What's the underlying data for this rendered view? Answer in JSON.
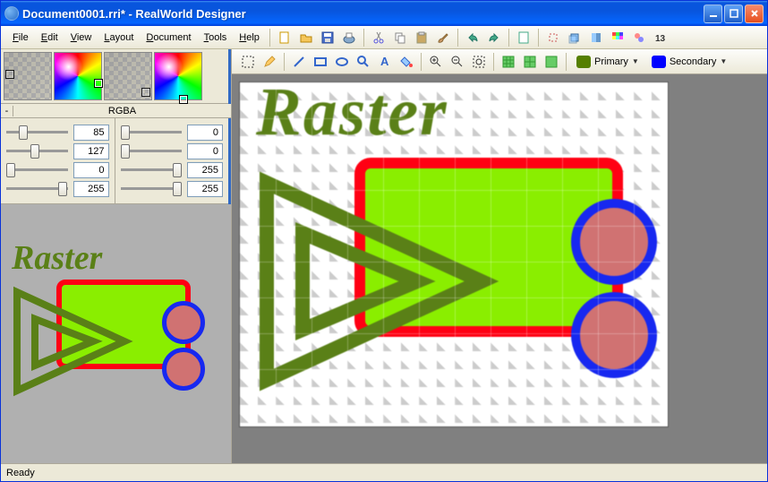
{
  "window": {
    "title": "Document0001.rri* - RealWorld Designer"
  },
  "menu": {
    "file": "File",
    "edit": "Edit",
    "view": "View",
    "layout": "Layout",
    "document": "Document",
    "tools": "Tools",
    "help": "Help"
  },
  "rgba": {
    "label": "RGBA",
    "minus": "-",
    "left": {
      "r": "85",
      "g": "127",
      "b": "0",
      "a": "255"
    },
    "right": {
      "r": "0",
      "g": "0",
      "b": "255",
      "a": "255"
    }
  },
  "color_dropdowns": {
    "primary_label": "Primary",
    "primary_color": "#557f00",
    "secondary_label": "Secondary",
    "secondary_color": "#0000ff"
  },
  "artwork": {
    "text": "Raster"
  },
  "status": {
    "text": "Ready"
  },
  "toolbar_icons": {
    "row1": [
      "new-icon",
      "open-icon",
      "save-icon",
      "print-icon",
      "cut-icon",
      "copy-icon",
      "paste-icon",
      "brush-icon",
      "undo-icon",
      "redo-icon",
      "doc-icon",
      "crop-icon",
      "rotate-icon",
      "flip-icon",
      "color-icon",
      "eyedrop-icon",
      "link-icon"
    ],
    "row2": [
      "select-rect-icon",
      "pencil-icon",
      "line-icon",
      "rect-tool-icon",
      "ellipse-tool-icon",
      "magnify-icon",
      "text-tool-icon",
      "fill-icon",
      "zoom-in-icon",
      "zoom-out-icon",
      "fit-icon",
      "grid1-icon",
      "grid2-icon",
      "grid3-icon"
    ]
  }
}
